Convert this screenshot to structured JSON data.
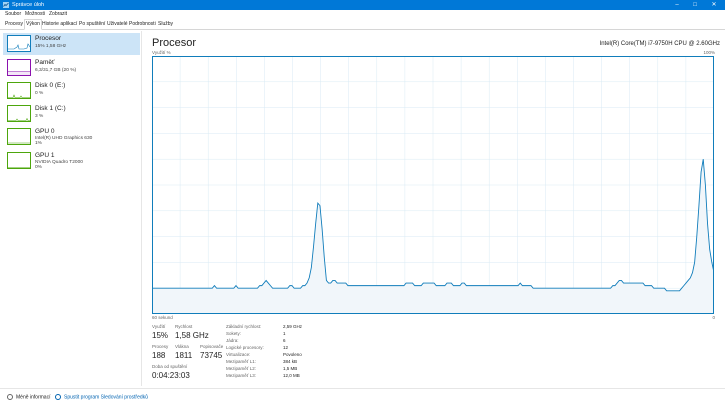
{
  "window": {
    "title": "Správce úloh",
    "minimize": "–",
    "maximize": "□",
    "close": "✕"
  },
  "menu": [
    "Soubor",
    "Možnosti",
    "Zobrazit"
  ],
  "tabs": [
    "Procesy",
    "Výkon",
    "Historie aplikací",
    "Po spuštění",
    "Uživatelé",
    "Podrobnosti",
    "Služby"
  ],
  "active_tab": "Výkon",
  "sidebar": {
    "items": [
      {
        "name": "Procesor",
        "lines": [
          "15%  1,58 GHz"
        ],
        "color": "#117dbb"
      },
      {
        "name": "Paměť",
        "lines": [
          "6,3/31,7 GB (20 %)"
        ],
        "color": "#8b12ae"
      },
      {
        "name": "Disk 0 (E:)",
        "lines": [
          "0 %"
        ],
        "color": "#4da60c"
      },
      {
        "name": "Disk 1 (C:)",
        "lines": [
          "3 %"
        ],
        "color": "#4da60c"
      },
      {
        "name": "GPU 0",
        "lines": [
          "Intel(R) UHD Graphics 630",
          "1%"
        ],
        "color": "#4da60c"
      },
      {
        "name": "GPU 1",
        "lines": [
          "NVIDIA Quadro T2000",
          "0%"
        ],
        "color": "#4da60c"
      }
    ]
  },
  "main": {
    "title": "Procesor",
    "cpu_model": "Intel(R) Core(TM) i7-9750H CPU @ 2.60GHz",
    "graph_label_tl": "Využití %",
    "graph_label_tr": "100%",
    "graph_label_bl": "60 sekund",
    "graph_label_br": "0"
  },
  "stats": {
    "vyuziti_label": "Využití",
    "vyuziti": "15%",
    "rychlost_label": "Rychlost",
    "rychlost": "1,58 GHz",
    "procesy_label": "Procesy",
    "procesy": "188",
    "vlakna_label": "Vlákna",
    "vlakna": "1811",
    "popisovace_label": "Popisovače",
    "popisovace": "73745",
    "doba_label": "Doba od spuštění",
    "doba": "0:04:23:03"
  },
  "specs": [
    {
      "key": "Základní rychlost:",
      "value": "2,59 GHz"
    },
    {
      "key": "Sokety:",
      "value": "1"
    },
    {
      "key": "Jádra:",
      "value": "6"
    },
    {
      "key": "Logické procesory:",
      "value": "12"
    },
    {
      "key": "Virtualizace:",
      "value": "Povoleno"
    },
    {
      "key": "Mezipaměť L1:",
      "value": "384 kB"
    },
    {
      "key": "Mezipaměť L2:",
      "value": "1,5 MB"
    },
    {
      "key": "Mezipaměť L3:",
      "value": "12,0 MB"
    }
  ],
  "footer": {
    "less_info": "Méně informací",
    "open_monitor": "Spustit program Sledování prostředků"
  },
  "cpu_history": [
    10,
    10,
    10,
    10,
    10,
    10,
    10,
    10,
    10,
    10,
    10,
    10,
    10,
    10,
    10,
    10,
    10,
    10,
    10,
    10,
    10,
    10,
    10,
    10,
    10,
    10,
    10,
    10,
    10,
    11,
    10,
    10,
    10,
    10,
    10,
    10,
    10,
    10,
    10,
    11,
    10,
    10,
    10,
    10,
    10,
    10,
    10,
    10,
    10,
    10,
    11,
    11,
    12,
    13,
    12,
    11,
    10,
    10,
    10,
    10,
    10,
    10,
    10,
    10,
    11,
    11,
    10,
    10,
    10,
    10,
    11,
    11,
    12,
    14,
    18,
    26,
    35,
    43,
    42,
    33,
    22,
    13,
    12,
    12,
    13,
    13,
    12,
    12,
    12,
    12,
    12,
    11,
    11,
    11,
    11,
    11,
    11,
    11,
    11,
    11,
    11,
    11,
    11,
    11,
    11,
    11,
    11,
    11,
    11,
    11,
    11,
    11,
    11,
    11,
    11,
    11,
    11,
    11,
    12,
    12,
    12,
    12,
    11,
    11,
    11,
    11,
    12,
    12,
    12,
    12,
    12,
    12,
    11,
    11,
    11,
    11,
    11,
    12,
    12,
    12,
    11,
    11,
    11,
    11,
    12,
    12,
    11,
    11,
    11,
    11,
    11,
    11,
    11,
    11,
    11,
    11,
    11,
    11,
    11,
    11,
    11,
    11,
    11,
    11,
    11,
    11,
    11,
    11,
    11,
    11,
    11,
    12,
    11,
    11,
    11,
    11,
    11,
    10,
    10,
    10,
    10,
    10,
    10,
    10,
    10,
    10,
    10,
    10,
    10,
    10,
    10,
    10,
    10,
    10,
    10,
    10,
    10,
    10,
    10,
    10,
    10,
    10,
    10,
    10,
    10,
    10,
    10,
    10,
    10,
    10,
    10,
    10,
    10,
    10,
    11,
    11,
    12,
    13,
    13,
    12,
    12,
    12,
    12,
    12,
    12,
    12,
    12,
    12,
    12,
    11,
    11,
    11,
    11,
    10,
    10,
    10,
    10,
    10,
    10,
    9,
    9,
    9,
    9,
    9,
    9,
    9,
    10,
    11,
    12,
    13,
    14,
    16,
    20,
    30,
    42,
    55,
    60,
    50,
    35,
    25,
    20,
    16
  ],
  "colors": {
    "accent": "#117dbb",
    "graph_fill": "#f1f6fa",
    "grid": "#d9eaf4",
    "titlebar": "#0078d7"
  }
}
